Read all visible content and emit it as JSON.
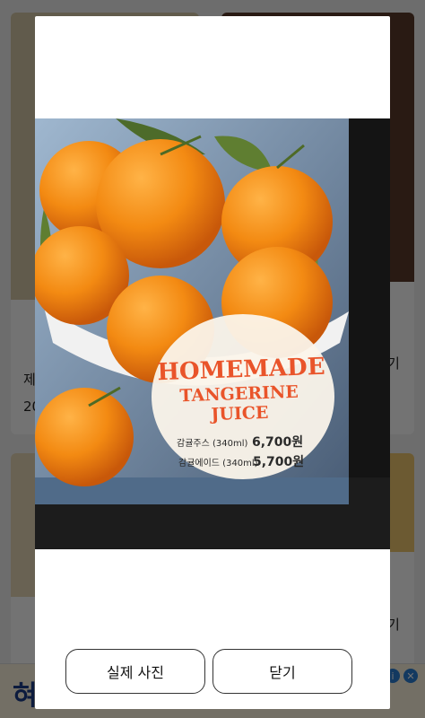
{
  "background": {
    "card_text_left_1": "제",
    "card_text_left_2": "20",
    "card_text_right_1": "기",
    "card_text_right_2": "기",
    "ad_text": "혀",
    "ad_info_icon": "info-icon",
    "ad_close_icon": "close-icon"
  },
  "photo": {
    "title_line1": "HOMEMADE",
    "title_line2": "TANGERINE JUICE",
    "description": "",
    "items": [
      {
        "name": "감귤주스 (340ml)",
        "price": "6,700원"
      },
      {
        "name": "감귤에이드 (340ml)",
        "price": "5,700원"
      }
    ]
  },
  "buttons": {
    "real_photo": "실제 사진",
    "close": "닫기"
  },
  "colors": {
    "accent": "#e9542a",
    "overlay": "rgba(0,0,0,0.55)",
    "modal_bg": "#ffffff"
  }
}
